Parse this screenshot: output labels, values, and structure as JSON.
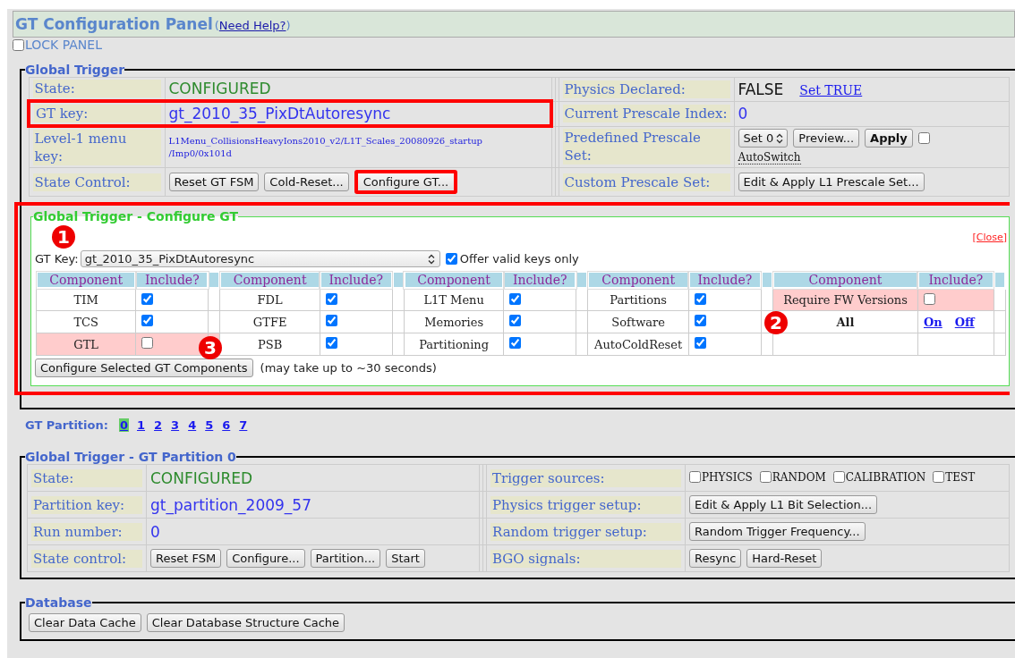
{
  "header": {
    "title": "GT Configuration Panel",
    "help_open": "(",
    "help_link": "Need Help?",
    "help_close": ")"
  },
  "lock_panel": {
    "label": "LOCK PANEL",
    "checked": false
  },
  "global_trigger": {
    "legend": "Global Trigger",
    "left_rows": [
      {
        "label": "State:",
        "kind": "status",
        "value": "CONFIGURED",
        "highlighted": false
      },
      {
        "label": "GT key:",
        "kind": "key",
        "value": "gt_2010_35_PixDtAutoresync",
        "highlighted": true
      },
      {
        "label": "Level-1 menu key:",
        "kind": "small",
        "lines": [
          "L1Menu_CollisionsHeavyIons2010_v2/L1T_Scales_20080926_startup",
          "/Imp0/0x101d"
        ],
        "highlighted": false
      },
      {
        "label": "State Control:",
        "kind": "buttons",
        "highlighted": false,
        "buttons": [
          {
            "label": "Reset GT FSM",
            "bold": false,
            "highlighted": false
          },
          {
            "label": "Cold-Reset...",
            "bold": false,
            "highlighted": false
          },
          {
            "label": "Configure GT...",
            "bold": false,
            "highlighted": true
          }
        ]
      }
    ],
    "right_rows": [
      {
        "label": "Physics Declared:",
        "kind": "flag",
        "value": "FALSE",
        "link": "Set TRUE"
      },
      {
        "label": "Current Prescale Index:",
        "kind": "key",
        "value": "0"
      },
      {
        "label": "Predefined Prescale Set:",
        "kind": "prescale",
        "select": "Set 0",
        "buttons": [
          {
            "label": "Preview...",
            "bold": false
          },
          {
            "label": "Apply",
            "bold": true
          }
        ],
        "autoswitch": {
          "label": "AutoSwitch",
          "checked": false
        }
      },
      {
        "label": "Custom Prescale Set:",
        "kind": "buttons",
        "buttons": [
          {
            "label": "Edit & Apply L1 Prescale Set...",
            "bold": false
          }
        ]
      }
    ]
  },
  "configure": {
    "legend": "Global Trigger - Configure GT",
    "highlighted": true,
    "close": "[Close]",
    "gt_key_label": "GT Key:",
    "gt_key_value": "gt_2010_35_PixDtAutoresync",
    "valid_only": {
      "label": "Offer valid keys only",
      "checked": true
    },
    "groups": [
      {
        "columns": [
          "Component",
          "Include?"
        ],
        "rows": [
          {
            "kind": "check",
            "name": "TIM",
            "checked": true,
            "warning": false
          },
          {
            "kind": "check",
            "name": "TCS",
            "checked": true,
            "warning": false
          },
          {
            "kind": "check",
            "name": "GTL",
            "checked": false,
            "warning": true
          }
        ]
      },
      {
        "columns": [
          "Component",
          "Include?"
        ],
        "rows": [
          {
            "kind": "check",
            "name": "FDL",
            "checked": true,
            "warning": false
          },
          {
            "kind": "check",
            "name": "GTFE",
            "checked": true,
            "warning": false
          },
          {
            "kind": "check",
            "name": "PSB",
            "checked": true,
            "warning": false
          }
        ]
      },
      {
        "columns": [
          "Component",
          "Include?"
        ],
        "rows": [
          {
            "kind": "check",
            "name": "L1T Menu",
            "checked": true,
            "warning": false
          },
          {
            "kind": "check",
            "name": "Memories",
            "checked": true,
            "warning": false
          },
          {
            "kind": "check",
            "name": "Partitioning",
            "checked": true,
            "warning": false
          }
        ]
      },
      {
        "columns": [
          "Component",
          "Include?"
        ],
        "rows": [
          {
            "kind": "check",
            "name": "Partitions",
            "checked": true,
            "warning": false
          },
          {
            "kind": "check",
            "name": "Software",
            "checked": true,
            "warning": false
          },
          {
            "kind": "check",
            "name": "AutoColdReset",
            "checked": true,
            "warning": false
          }
        ]
      },
      {
        "columns": [
          "Component",
          "Include?"
        ],
        "rows": [
          {
            "kind": "check",
            "name": "Require FW Versions",
            "checked": false,
            "warning": true
          },
          {
            "kind": "all",
            "name": "All",
            "on": "On",
            "off": "Off"
          }
        ]
      }
    ],
    "configure_button": "Configure Selected GT Components",
    "note": "(may take up to ~30 seconds)",
    "markers": [
      {
        "label": "1"
      },
      {
        "label": "2"
      },
      {
        "label": "3"
      }
    ]
  },
  "partitions": {
    "label": "GT Partition:",
    "items": [
      {
        "label": "0",
        "selected": true
      },
      {
        "label": "1",
        "selected": false
      },
      {
        "label": "2",
        "selected": false
      },
      {
        "label": "3",
        "selected": false
      },
      {
        "label": "4",
        "selected": false
      },
      {
        "label": "5",
        "selected": false
      },
      {
        "label": "6",
        "selected": false
      },
      {
        "label": "7",
        "selected": false
      }
    ]
  },
  "partition_panel": {
    "legend": "Global Trigger - GT Partition 0",
    "left_rows": [
      {
        "label": "State:",
        "kind": "status",
        "value": "CONFIGURED"
      },
      {
        "label": "Partition key:",
        "kind": "key",
        "value": "gt_partition_2009_57"
      },
      {
        "label": "Run number:",
        "kind": "key",
        "value": "0"
      },
      {
        "label": "State control:",
        "kind": "buttons",
        "buttons": [
          {
            "label": "Reset FSM",
            "bold": false
          },
          {
            "label": "Configure...",
            "bold": false
          },
          {
            "label": "Partition...",
            "bold": false
          },
          {
            "label": "Start",
            "bold": false
          }
        ]
      }
    ],
    "right_rows": [
      {
        "label": "Trigger sources:",
        "kind": "checks",
        "checks": [
          {
            "label": "PHYSICS",
            "checked": false
          },
          {
            "label": "RANDOM",
            "checked": false
          },
          {
            "label": "CALIBRATION",
            "checked": false
          },
          {
            "label": "TEST",
            "checked": false
          }
        ]
      },
      {
        "label": "Physics trigger setup:",
        "kind": "buttons",
        "buttons": [
          {
            "label": "Edit & Apply L1 Bit Selection...",
            "bold": false
          }
        ]
      },
      {
        "label": "Random trigger setup:",
        "kind": "buttons",
        "buttons": [
          {
            "label": "Random Trigger Frequency...",
            "bold": false
          }
        ]
      },
      {
        "label": "BGO signals:",
        "kind": "buttons",
        "buttons": [
          {
            "label": "Resync",
            "bold": false
          },
          {
            "label": "Hard-Reset",
            "bold": false
          }
        ]
      }
    ]
  },
  "database": {
    "legend": "Database",
    "buttons": [
      {
        "label": "Clear Data Cache",
        "bold": false
      },
      {
        "label": "Clear Database Structure Cache",
        "bold": false
      }
    ]
  }
}
